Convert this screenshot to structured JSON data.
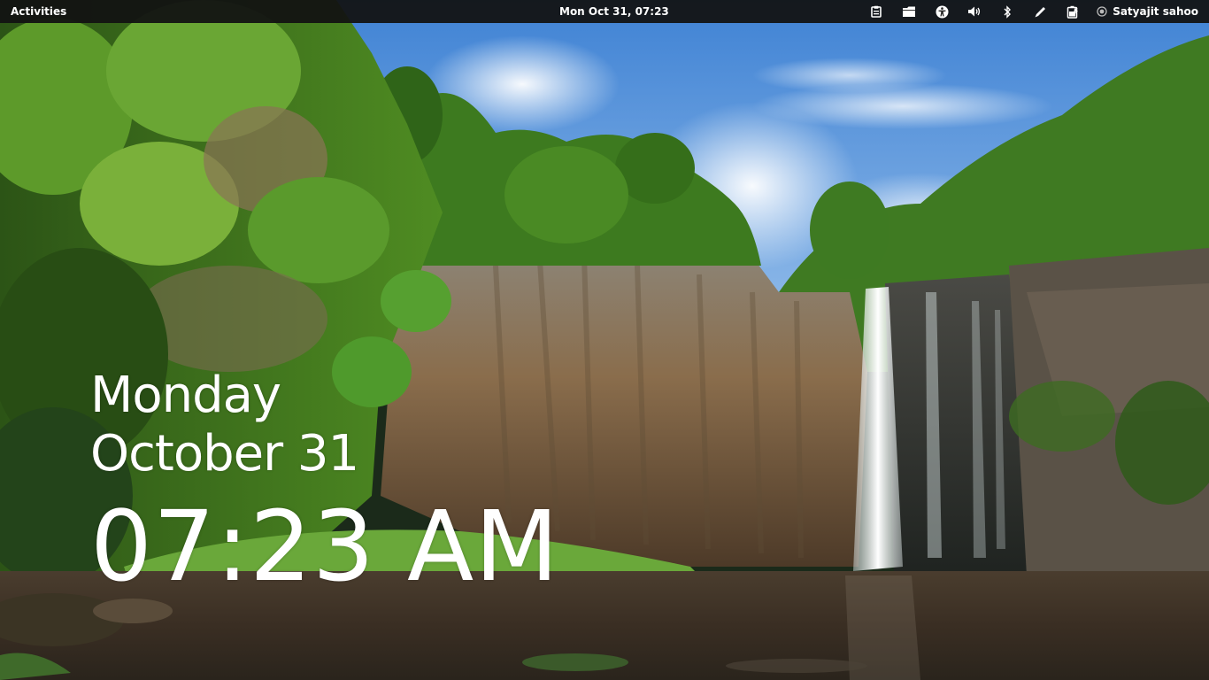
{
  "topbar": {
    "activities_label": "Activities",
    "clock_label": "Mon Oct 31, 07:23",
    "status_icons": [
      "clipboard-icon",
      "files-icon",
      "accessibility-icon",
      "volume-icon",
      "bluetooth-icon",
      "pen-icon",
      "battery-icon"
    ],
    "user_icon": "user-available-icon",
    "user_name": "Satyajit sahoo"
  },
  "lock_screen": {
    "day": "Monday",
    "date": "October 31",
    "time": "07:23 AM"
  },
  "wallpaper": {
    "subject": "waterfall",
    "colors": {
      "sky": "#4f8fd6",
      "foliage": "#4f8a24",
      "cliff": "#7a6448",
      "water": "#3a2e22",
      "grass": "#6aa83a"
    }
  }
}
